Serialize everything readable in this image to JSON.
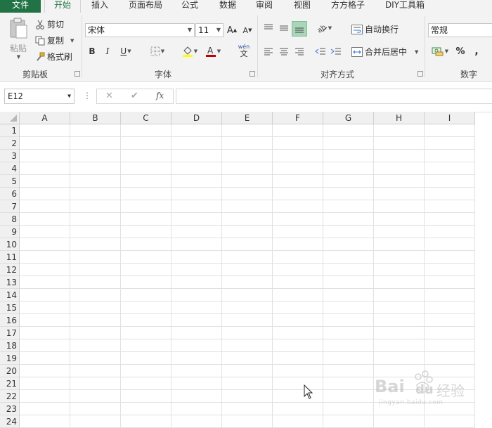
{
  "tabs": [
    {
      "label": "文件",
      "kind": "file"
    },
    {
      "label": "开始",
      "kind": "active"
    },
    {
      "label": "插入",
      "kind": "normal"
    },
    {
      "label": "页面布局",
      "kind": "normal"
    },
    {
      "label": "公式",
      "kind": "normal"
    },
    {
      "label": "数据",
      "kind": "normal"
    },
    {
      "label": "审阅",
      "kind": "normal"
    },
    {
      "label": "视图",
      "kind": "normal"
    },
    {
      "label": "方方格子",
      "kind": "normal"
    },
    {
      "label": "DIY工具箱",
      "kind": "normal"
    }
  ],
  "clipboard": {
    "paste": "粘贴",
    "cut": "剪切",
    "copy": "复制",
    "format_painter": "格式刷",
    "group_label": "剪贴板"
  },
  "font": {
    "font_name": "宋体",
    "font_size": "11",
    "bold": "B",
    "italic": "I",
    "underline": "U",
    "grow": "A",
    "shrink": "A",
    "phonetic_top": "wén",
    "phonetic_bottom": "文",
    "group_label": "字体"
  },
  "alignment": {
    "wrap_text": "自动换行",
    "merge_center": "合并后居中",
    "group_label": "对齐方式"
  },
  "number": {
    "format": "常规",
    "percent": "%",
    "comma": ",",
    "group_label": "数字"
  },
  "formula_bar": {
    "name_box": "E12",
    "more": "⋮",
    "cancel": "✕",
    "enter": "✔",
    "fx": "fx",
    "content": ""
  },
  "columns": [
    "A",
    "B",
    "C",
    "D",
    "E",
    "F",
    "G",
    "H",
    "I"
  ],
  "rows": [
    "1",
    "2",
    "3",
    "4",
    "5",
    "6",
    "7",
    "8",
    "9",
    "10",
    "11",
    "12",
    "13",
    "14",
    "15",
    "16",
    "17",
    "18",
    "19",
    "20",
    "21",
    "22",
    "23",
    "24"
  ],
  "colors": {
    "excel_green": "#217346",
    "fill_yellow": "#ffff00",
    "font_red": "#c00000",
    "align_active": "#a9d5b9"
  },
  "watermark": {
    "brand": "Bai",
    "brand2": "du",
    "label": "经验",
    "url": "jingyan.baidu.com"
  }
}
